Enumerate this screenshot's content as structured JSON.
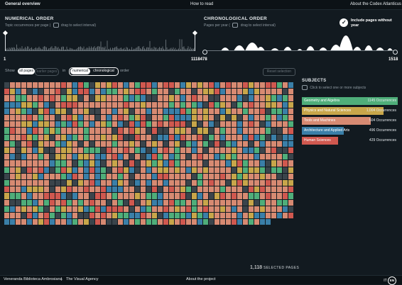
{
  "nav": {
    "general_overview": "General overview",
    "how_to_read": "How to read",
    "about_codex": "About the Codex Atlanticus"
  },
  "numerical": {
    "title": "NUMERICAL ORDER",
    "subtitle_a": "Topic occurrences per page |",
    "subtitle_b": "drag to select interval)",
    "min_label": "1",
    "max_label": "1118478"
  },
  "chronological": {
    "title": "CHRONOLOGICAL ORDER",
    "subtitle_a": "Pages per year (",
    "subtitle_b": "drag to select interval)",
    "max_label": "1518"
  },
  "include": {
    "check": "✓",
    "label": "Include pages without year"
  },
  "controls": {
    "show": "Show",
    "all_pages": "all pages",
    "earlier_pages": "earlier pages",
    "in": "in",
    "numerical": "numerical",
    "chronological": "chronological",
    "order": "order",
    "reset": "Reset selection"
  },
  "subjects": {
    "title": "SUBJECTS",
    "hint": "Click to select one or more subjects",
    "items": [
      {
        "name": "Geometry and Algebra",
        "count": "1145 Occurrences",
        "color": "#4fae7a",
        "frac": 1.0
      },
      {
        "name": "Physics and Natural Sciences",
        "count": "1,004 Occurrences",
        "color": "#c8a64a",
        "frac": 0.85
      },
      {
        "name": "Tools and Machines",
        "count": "504 Occurrences",
        "color": "#d78a72",
        "frac": 0.72
      },
      {
        "name": "Architecture and Applied Arts",
        "count": "496 Occurrences",
        "color": "#3a7fa8",
        "frac": 0.44
      },
      {
        "name": "Human Sciences",
        "count": "429 Occurrences",
        "color": "#d0584f",
        "frac": 0.38
      }
    ]
  },
  "selected": {
    "count": "1,118",
    "label": "SELECTED PAGES"
  },
  "footer": {
    "library": "Veneranda Biblioteca Ambrosiana",
    "sep": "|",
    "agency": "The Visual Agency",
    "about": "About the project",
    "lang_it": "IT",
    "lang_en": "EN"
  },
  "colors": {
    "tools": "#d78a72",
    "geometry": "#4fae7a",
    "physics": "#c8a64a",
    "architecture": "#3a7fa8",
    "human": "#d0584f",
    "empty": "#3a444b"
  },
  "grid_tiles": 1118
}
